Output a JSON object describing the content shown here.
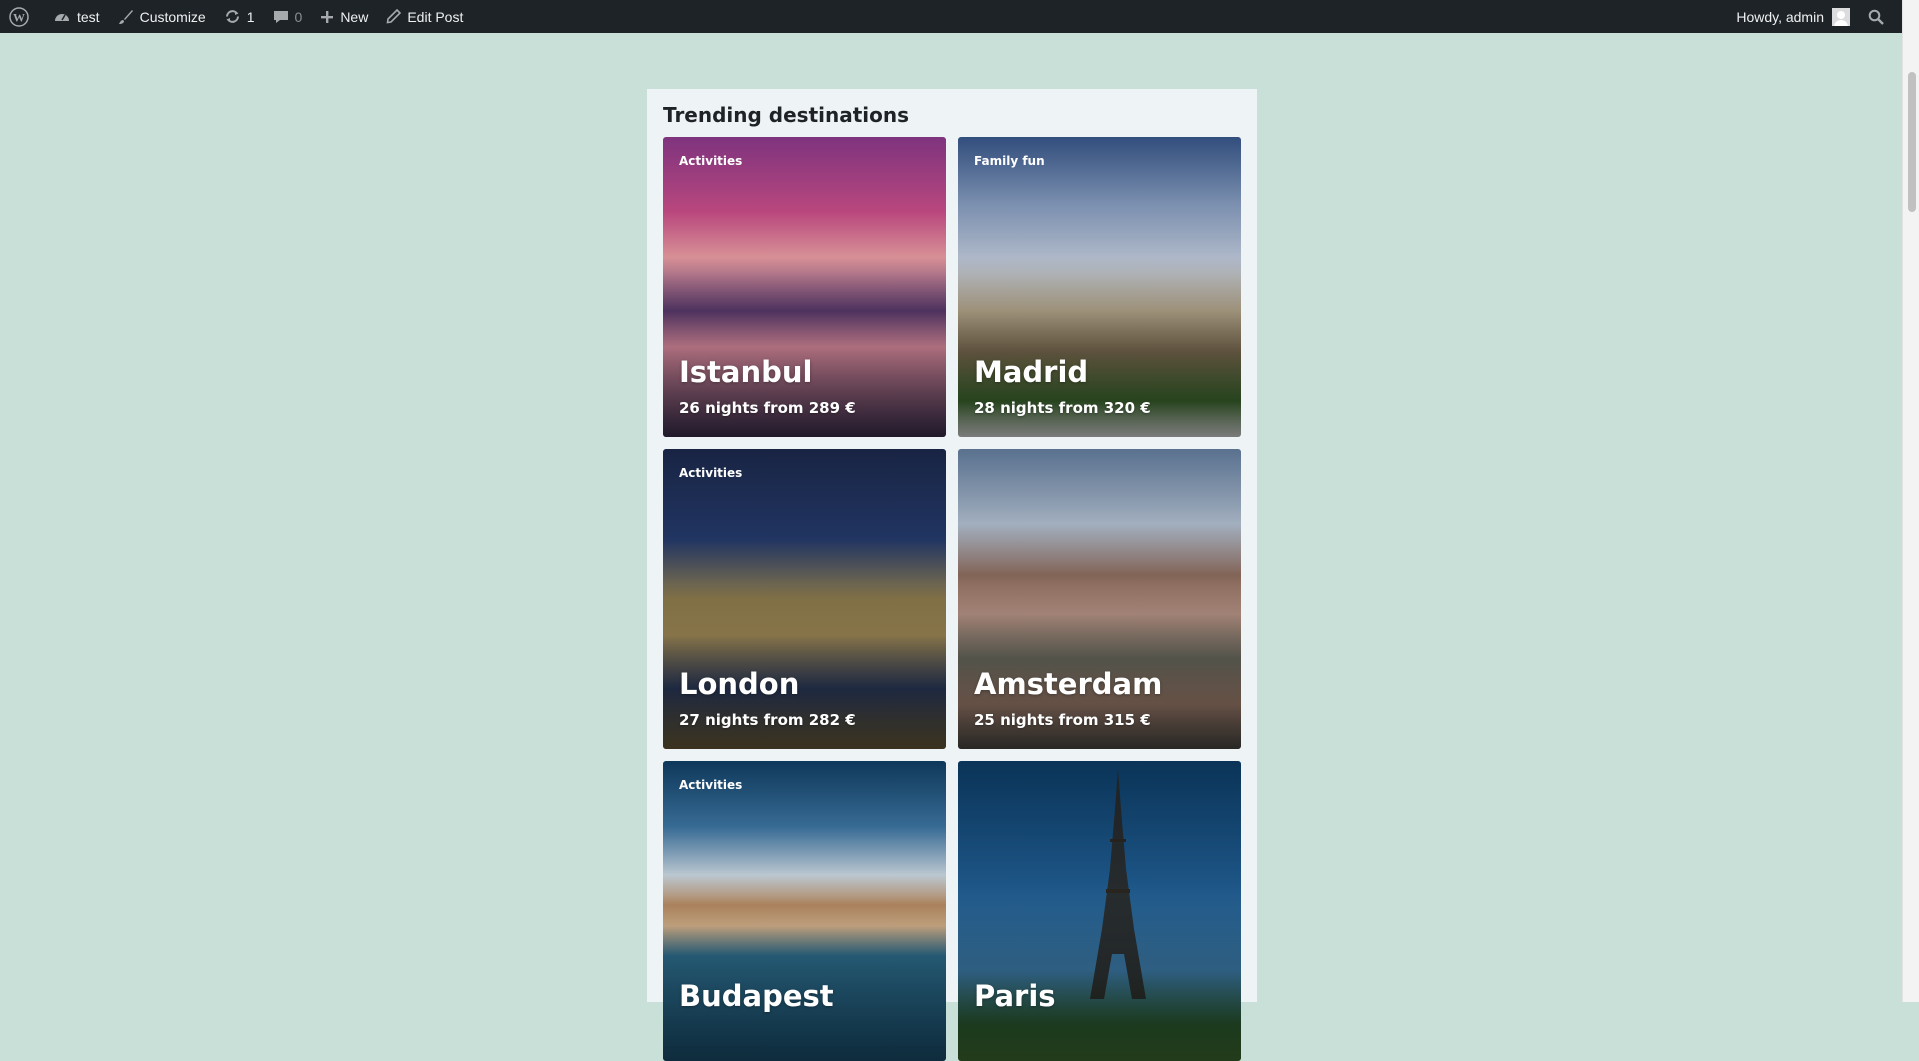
{
  "adminbar": {
    "site_name": "test",
    "customize_label": "Customize",
    "updates_count": "1",
    "comments_count": "0",
    "new_label": "New",
    "edit_label": "Edit Post",
    "greeting": "Howdy, admin"
  },
  "section": {
    "title": "Trending destinations"
  },
  "cards": [
    {
      "tag": "Activities",
      "city": "Istanbul",
      "price": "26 nights from 289 €"
    },
    {
      "tag": "Family fun",
      "city": "Madrid",
      "price": "28 nights from 320 €"
    },
    {
      "tag": "Activities",
      "city": "London",
      "price": "27 nights from 282 €"
    },
    {
      "tag": "",
      "city": "Amsterdam",
      "price": "25 nights from 315 €"
    },
    {
      "tag": "Activities",
      "city": "Budapest",
      "price": ""
    },
    {
      "tag": "",
      "city": "Paris",
      "price": ""
    }
  ],
  "icons": {
    "wp_logo": "wordpress-logo-icon",
    "dashboard": "dashboard-icon",
    "customize": "paintbrush-icon",
    "updates": "refresh-icon",
    "comments": "comment-icon",
    "new": "plus-icon",
    "edit": "pencil-icon",
    "search": "search-icon"
  },
  "colors": {
    "page_background": "#c9e0d8",
    "adminbar": "#1d2327",
    "panel": "#eef3f5"
  }
}
